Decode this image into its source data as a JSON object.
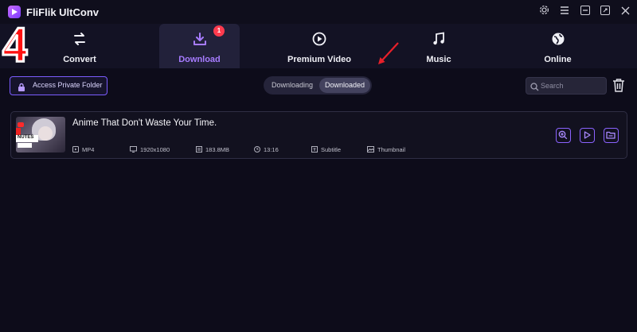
{
  "app": {
    "title": "FliFlik UltConv"
  },
  "window_controls": [
    "settings-icon",
    "menu-icon",
    "minimize-icon",
    "maximize-icon",
    "close-icon"
  ],
  "nav": {
    "tabs": [
      {
        "label": "Convert",
        "icon": "convert-arrows-icon",
        "active": false
      },
      {
        "label": "Download",
        "icon": "download-icon",
        "active": true,
        "badge": "1"
      },
      {
        "label": "Premium Video",
        "icon": "play-circle-icon",
        "active": false
      },
      {
        "label": "Music",
        "icon": "music-note-icon",
        "active": false
      },
      {
        "label": "Online",
        "icon": "globe-icon",
        "active": false
      }
    ]
  },
  "toolbar": {
    "private_folder_label": "Access Private Folder",
    "segments": [
      "Downloading",
      "Downloaded"
    ],
    "selected_segment": "Downloaded",
    "search_placeholder": "Search"
  },
  "videos": [
    {
      "title": "Anime That Don't Waste Your Time.",
      "thumb_text": "NUTES",
      "format": "MP4",
      "resolution": "1920x1080",
      "size": "183.8MB",
      "duration": "13:16",
      "subtitle": "Subtitle",
      "thumbnail": "Thumbnail"
    }
  ],
  "annotation": {
    "step_number": "4"
  },
  "colors": {
    "accent": "#8b63ff",
    "badge": "#ff3b4e",
    "background": "#0d0c1a"
  }
}
